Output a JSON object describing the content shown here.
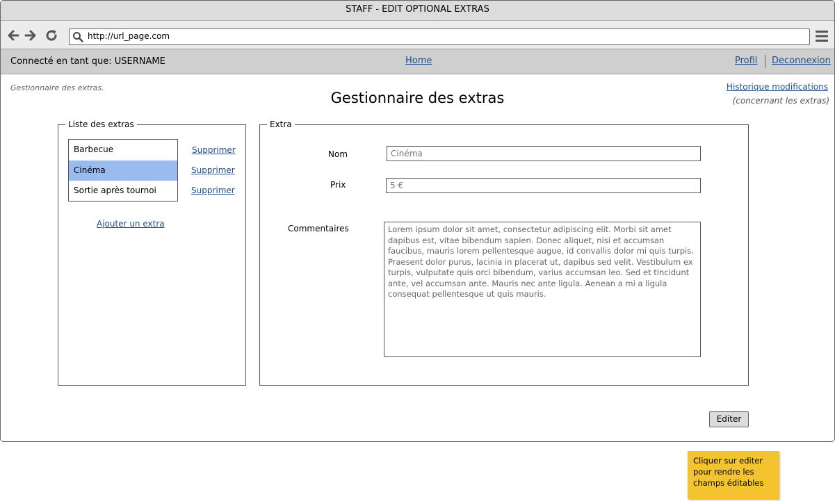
{
  "window": {
    "title": "STAFF - EDIT OPTIONAL EXTRAS"
  },
  "browser": {
    "url": "http://url_page.com"
  },
  "userbar": {
    "connected_as": "Connecté en tant que: USERNAME",
    "home": "Home",
    "profile": "Profil",
    "logout": "Deconnexion"
  },
  "page": {
    "breadcrumb": "Gestionnaire des extras.",
    "title": "Gestionnaire des extras",
    "history_link": "Historique modifications",
    "history_note": "(concernant les extras)"
  },
  "extras_list": {
    "legend": "Liste des extras",
    "items": [
      {
        "label": "Barbecue",
        "delete": "Supprimer",
        "selected": false
      },
      {
        "label": "Cinéma",
        "delete": "Supprimer",
        "selected": true
      },
      {
        "label": "Sortie après tournoi",
        "delete": "Supprimer",
        "selected": false
      }
    ],
    "add_link": "Ajouter un extra"
  },
  "extra_form": {
    "legend": "Extra",
    "name_label": "Nom",
    "name_value": "Cinéma",
    "price_label": "Prix",
    "price_value": "5 €",
    "comments_label": "Commentaires",
    "comments_value": "Lorem ipsum dolor sit amet, consectetur adipiscing elit. Morbi sit amet dapibus est, vitae bibendum sapien. Donec aliquet, nisi et accumsan faucibus, mauris lorem pellentesque augue, id convallis dolor mi quis turpis. Praesent dolor purus, lacinia in placerat ut, dapibus sed velit. Vestibulum ex turpis, vulputate quis orci bibendum, varius accumsan leo. Sed et tincidunt ante, vel accumsan ante. Mauris nec ante ligula. Aenean a mi a ligula consequat pellentesque ut quis mauris."
  },
  "actions": {
    "edit": "Editer"
  },
  "note": {
    "text": "Cliquer sur editer pour rendre les champs éditables"
  },
  "colors": {
    "selected_row": "#99bbee",
    "link": "#1f4e8c",
    "sticky_note": "#f3c430"
  }
}
